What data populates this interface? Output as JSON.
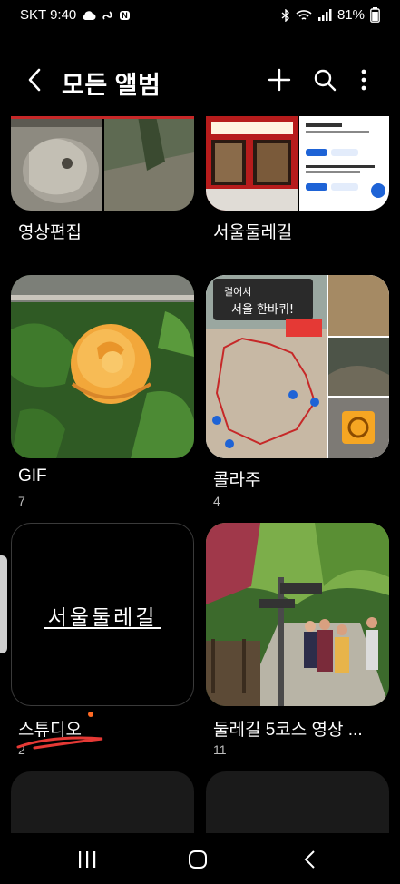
{
  "status": {
    "carrier_time": "SKT 9:40",
    "battery": "81%",
    "badge": "N"
  },
  "header": {
    "title": "모든 앨범"
  },
  "albums_top": [
    {
      "name": "영상편집"
    },
    {
      "name": "서울둘레길"
    }
  ],
  "albums": [
    {
      "name": "GIF",
      "count": "7"
    },
    {
      "name": "콜라주",
      "count": "4"
    },
    {
      "name": "스튜디오",
      "count": "2"
    },
    {
      "name": "둘레길 5코스 영상 ...",
      "count": "11"
    }
  ],
  "collage_text": {
    "sign_line1": "걸어서",
    "sign_line2": "서울 한바퀴!"
  },
  "studio_text": "서울둘레길",
  "colors": {
    "accent_dot": "#ff6a24",
    "background": "#000000"
  }
}
